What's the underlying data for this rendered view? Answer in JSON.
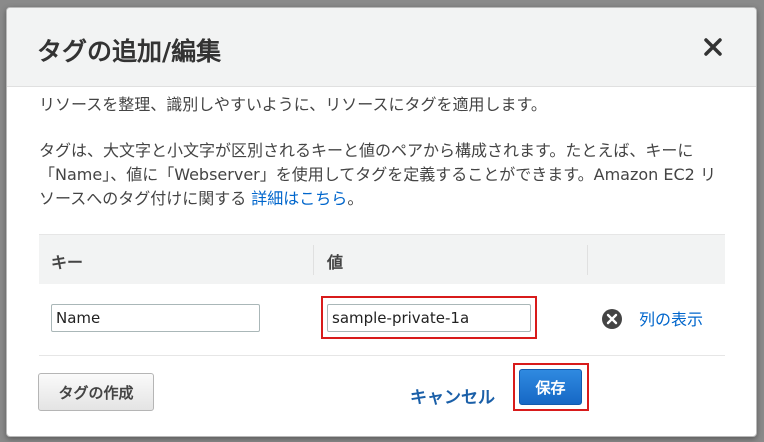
{
  "modal": {
    "title": "タグの追加/編集"
  },
  "description": {
    "line1": "リソースを整理、識別しやすいように、リソースにタグを適用します。",
    "line2": "タグは、大文字と小文字が区別されるキーと値のペアから構成されます。たとえば、キーに「Name」、値に「Webserver」を使用してタグを定義することができます。Amazon EC2 リソースへのタグ付けに関する",
    "link": "詳細はこちら",
    "link_suffix": "。"
  },
  "table": {
    "headers": {
      "key": "キー",
      "value": "値"
    },
    "rows": [
      {
        "key": "Name",
        "value": "sample-private-1a",
        "action_link": "列の表示"
      }
    ]
  },
  "footer": {
    "create_label": "タグの作成",
    "cancel_label": "キャンセル",
    "save_label": "保存"
  },
  "colors": {
    "accent": "#1668c5",
    "highlight": "#d81b1b",
    "link": "#0066cc"
  },
  "icons": {
    "close": "close-icon",
    "remove": "remove-circle-icon"
  }
}
